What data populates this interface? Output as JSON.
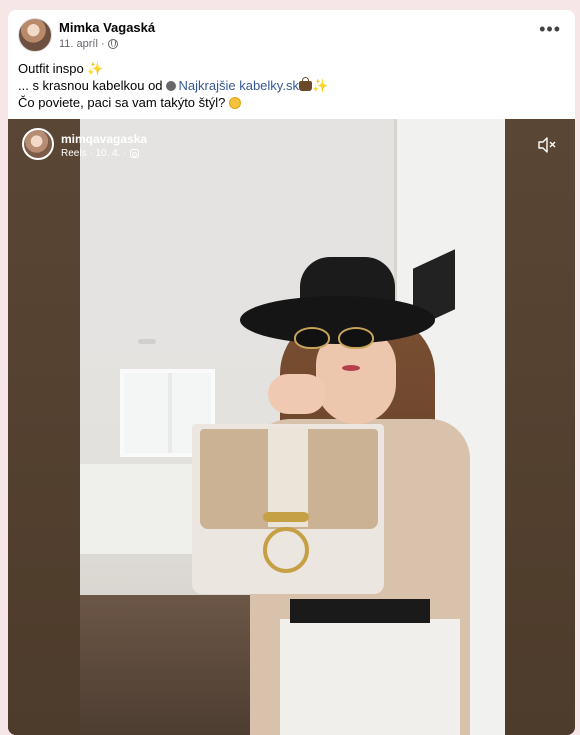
{
  "post": {
    "author": "Mimka Vagaská",
    "date": "11. apríl",
    "separator": "·",
    "privacy_icon": "globe-icon",
    "more_icon": "more-options-icon",
    "caption": {
      "line1_text": "Outfit inspo",
      "line1_emoji": "✨",
      "line2_prefix": "... s krasnou kabelkou od",
      "line2_link": "Najkrajšie kabelky.sk",
      "line2_emoji_end": "✨",
      "line3_text": "Čo poviete, paci sa vam takýto štýl?"
    }
  },
  "video": {
    "overlay_username": "mimqavagaska",
    "overlay_sub": "Reels · 10. 4. ·",
    "source_icon": "instagram-icon",
    "mute_icon": "speaker-muted-icon",
    "colors": {
      "link": "#385898",
      "page_bg": "#f6e6e8",
      "video_side": "#5a4632"
    }
  }
}
